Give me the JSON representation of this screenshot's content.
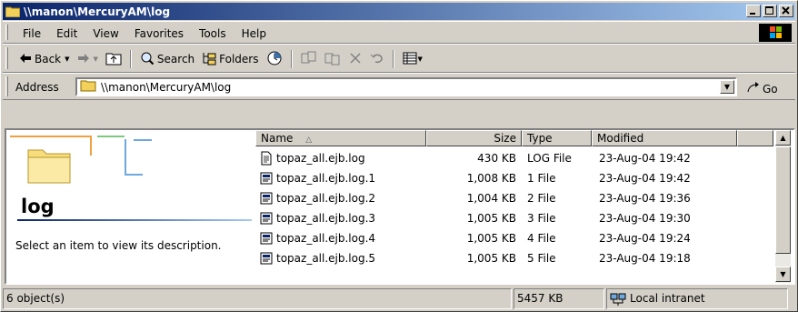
{
  "window": {
    "title": "\\\\manon\\MercuryAM\\log"
  },
  "menu": [
    "File",
    "Edit",
    "View",
    "Favorites",
    "Tools",
    "Help"
  ],
  "toolbar": {
    "back": "Back",
    "search": "Search",
    "folders": "Folders"
  },
  "address": {
    "label": "Address",
    "value": "\\\\manon\\MercuryAM\\log",
    "go": "Go"
  },
  "left_pane": {
    "title": "log",
    "description": "Select an item to view its description."
  },
  "list": {
    "columns": {
      "name": "Name",
      "size": "Size",
      "type": "Type",
      "modified": "Modified"
    },
    "sort_indicator": "△",
    "rows": [
      {
        "name": "topaz_all.ejb.log",
        "size": "430 KB",
        "type": "LOG File",
        "modified": "23-Aug-04 19:42",
        "icon": "log-file-icon"
      },
      {
        "name": "topaz_all.ejb.log.1",
        "size": "1,008 KB",
        "type": "1 File",
        "modified": "23-Aug-04 19:42",
        "icon": "generic-file-icon"
      },
      {
        "name": "topaz_all.ejb.log.2",
        "size": "1,004 KB",
        "type": "2 File",
        "modified": "23-Aug-04 19:36",
        "icon": "generic-file-icon"
      },
      {
        "name": "topaz_all.ejb.log.3",
        "size": "1,005 KB",
        "type": "3 File",
        "modified": "23-Aug-04 19:30",
        "icon": "generic-file-icon"
      },
      {
        "name": "topaz_all.ejb.log.4",
        "size": "1,005 KB",
        "type": "4 File",
        "modified": "23-Aug-04 19:24",
        "icon": "generic-file-icon"
      },
      {
        "name": "topaz_all.ejb.log.5",
        "size": "1,005 KB",
        "type": "5 File",
        "modified": "23-Aug-04 19:18",
        "icon": "generic-file-icon"
      }
    ]
  },
  "status": {
    "objects": "6 object(s)",
    "total_size": "5457 KB",
    "zone": "Local intranet"
  },
  "colors": {
    "titlebar_start": "#0a246a",
    "titlebar_end": "#a6caf0",
    "chrome": "#d4d0c8"
  }
}
